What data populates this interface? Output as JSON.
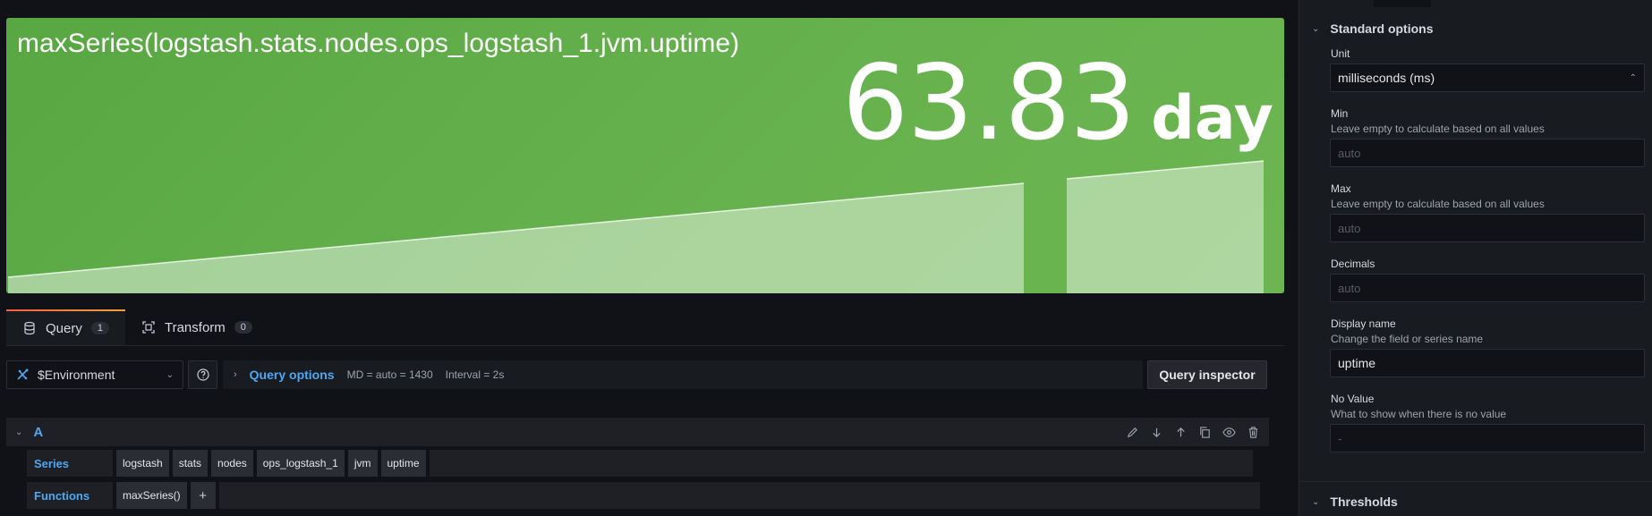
{
  "panel": {
    "title": "maxSeries(logstash.stats.nodes.ops_logstash_1.jvm.uptime)",
    "value": "63.83",
    "unit": "day",
    "background_color": "#5eac47",
    "sparkline_color": "rgba(255,255,255,0.45)"
  },
  "tabs": [
    {
      "label": "Query",
      "count": "1",
      "icon": "database-icon"
    },
    {
      "label": "Transform",
      "count": "0",
      "icon": "transform-icon"
    }
  ],
  "toolbar": {
    "datasource": "$Environment",
    "query_options_label": "Query options",
    "md_text": "MD = auto = 1430",
    "interval_text": "Interval = 2s",
    "query_inspector_label": "Query inspector"
  },
  "query": {
    "ref_id": "A",
    "series_label": "Series",
    "series_segments": [
      "logstash",
      "stats",
      "nodes",
      "ops_logstash_1",
      "jvm",
      "uptime"
    ],
    "functions_label": "Functions",
    "functions": [
      "maxSeries()"
    ],
    "add_label": "+"
  },
  "options": {
    "standard_options": "Standard options",
    "unit_label": "Unit",
    "unit_value": "milliseconds (ms)",
    "min_label": "Min",
    "min_desc": "Leave empty to calculate based on all values",
    "min_placeholder": "auto",
    "max_label": "Max",
    "max_desc": "Leave empty to calculate based on all values",
    "max_placeholder": "auto",
    "decimals_label": "Decimals",
    "decimals_placeholder": "auto",
    "display_name_label": "Display name",
    "display_name_desc": "Change the field or series name",
    "display_name_value": "uptime",
    "no_value_label": "No Value",
    "no_value_desc": "What to show when there is no value",
    "no_value_placeholder": "-",
    "thresholds": "Thresholds"
  },
  "colors": {
    "accent_blue": "#4ea8f2",
    "tab_highlight": "#f0a33a"
  }
}
